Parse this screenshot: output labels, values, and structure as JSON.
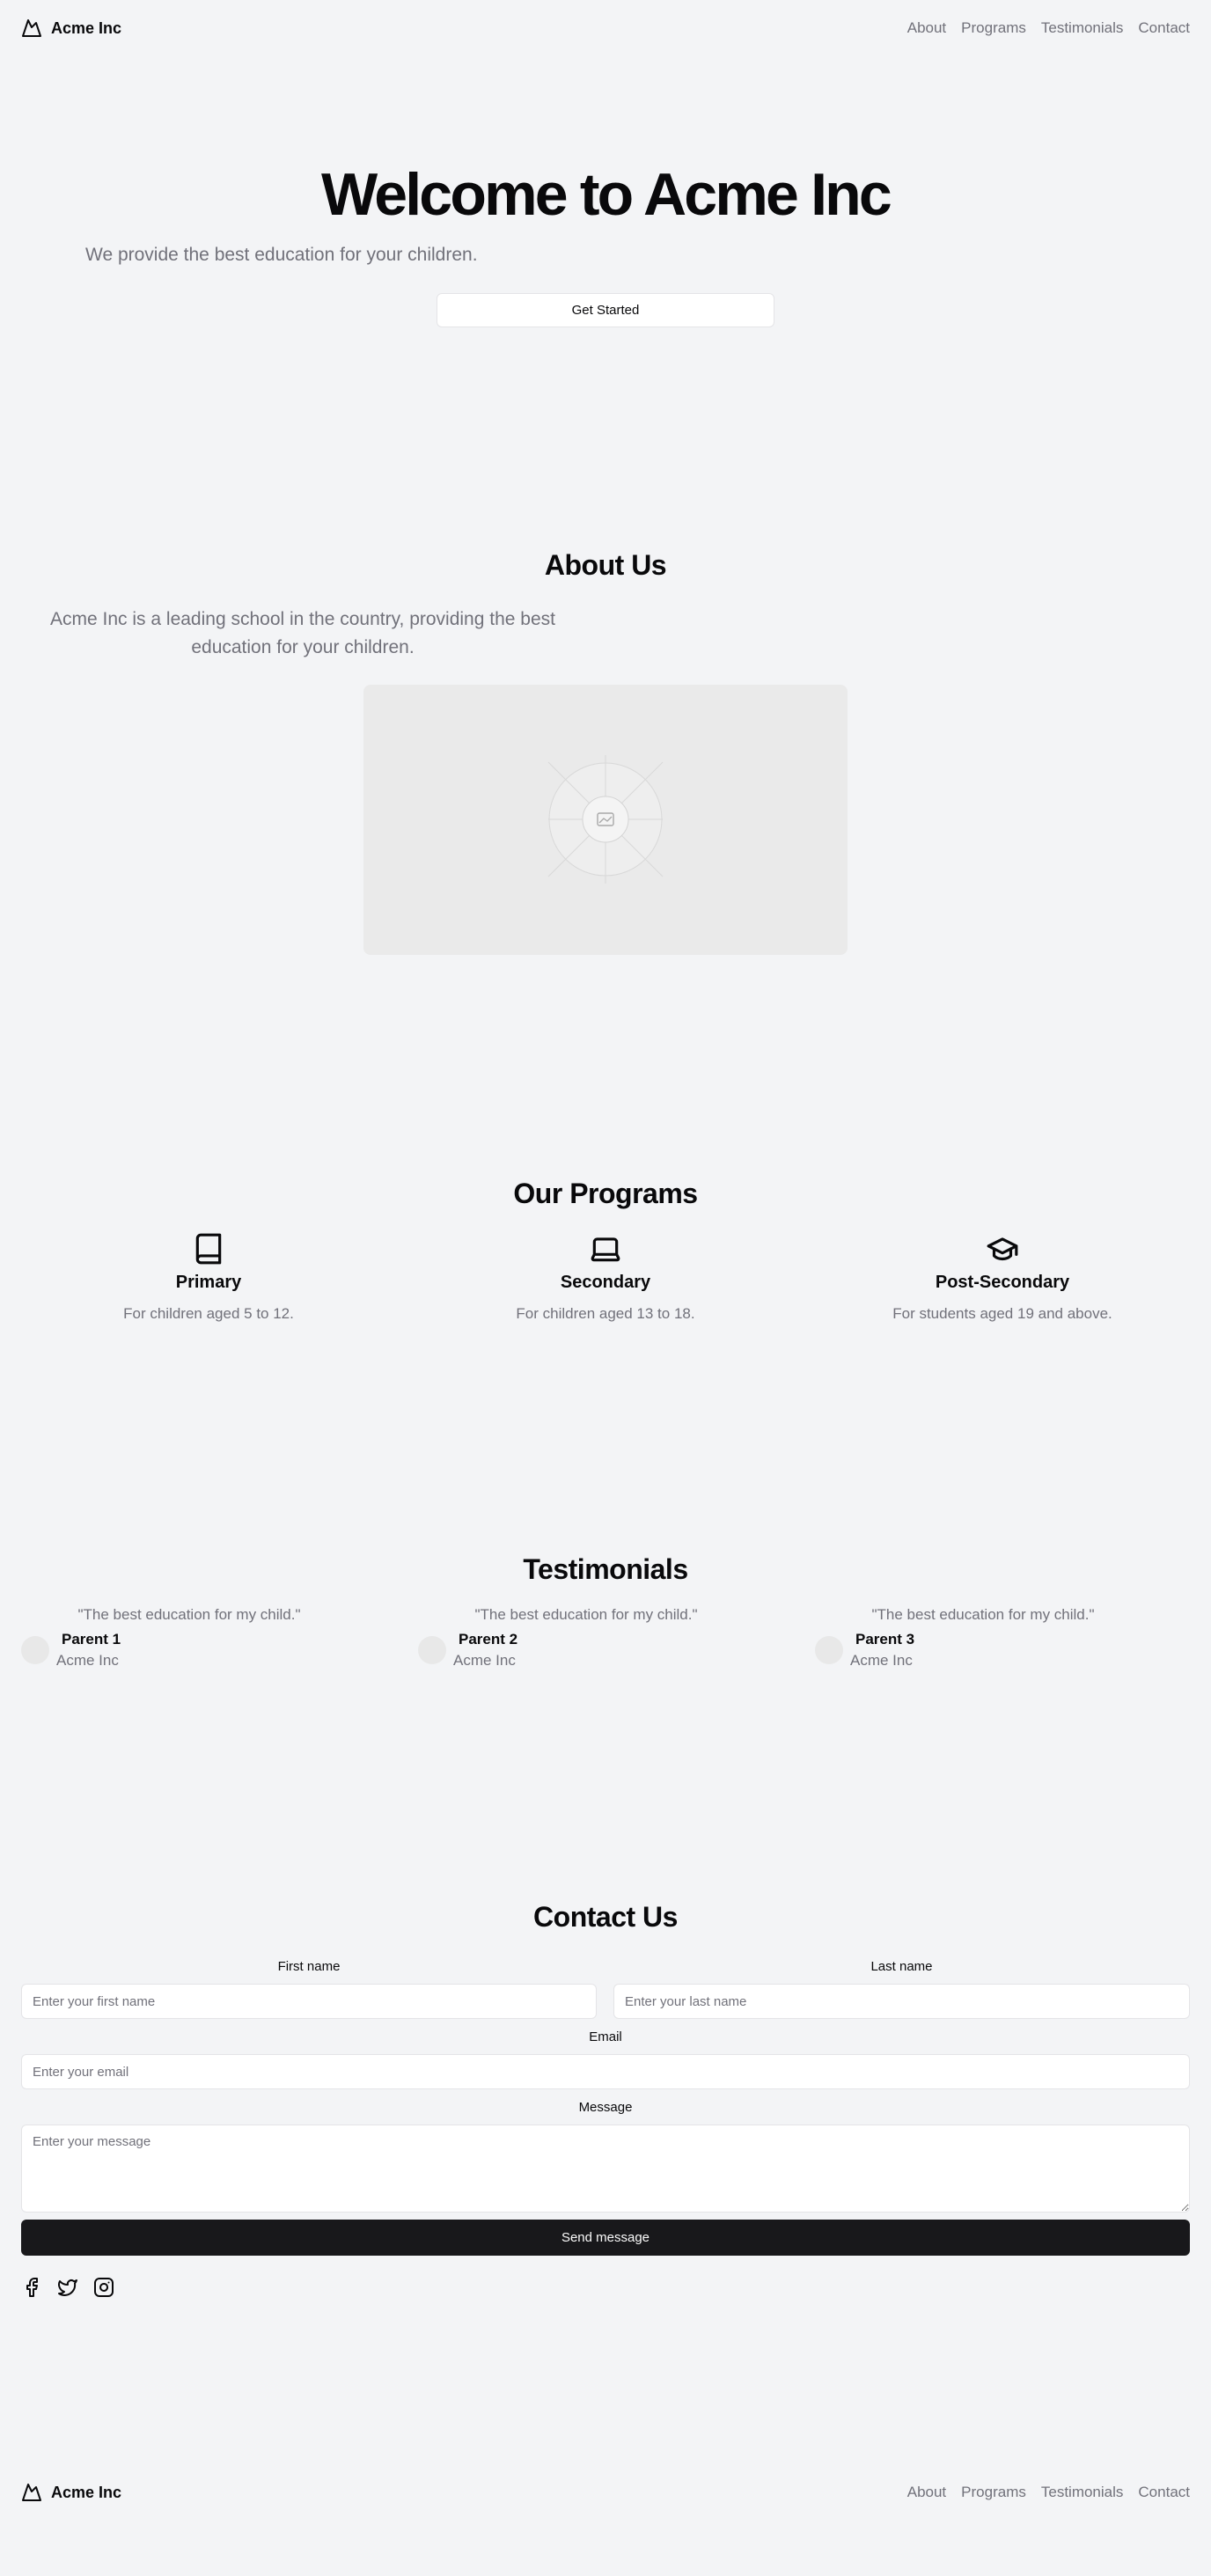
{
  "header": {
    "brand": "Acme Inc",
    "logo_icon": "mountain-icon",
    "nav": [
      "About",
      "Programs",
      "Testimonials",
      "Contact"
    ]
  },
  "hero": {
    "title": "Welcome to Acme Inc",
    "subtitle": "We provide the best education for your children.",
    "cta": "Get Started"
  },
  "about": {
    "title": "About Us",
    "text": "Acme Inc is a leading school in the country, providing the best education for your children.",
    "image_icon": "image-placeholder-icon"
  },
  "programs": {
    "title": "Our Programs",
    "items": [
      {
        "icon": "book-icon",
        "title": "Primary",
        "desc": "For children aged 5 to 12."
      },
      {
        "icon": "laptop-icon",
        "title": "Secondary",
        "desc": "For children aged 13 to 18."
      },
      {
        "icon": "graduation-cap-icon",
        "title": "Post-Secondary",
        "desc": "For students aged 19 and above."
      }
    ]
  },
  "testimonials": {
    "title": "Testimonials",
    "items": [
      {
        "quote": "\"The best education for my child.\"",
        "name": "Parent 1",
        "org": "Acme Inc"
      },
      {
        "quote": "\"The best education for my child.\"",
        "name": "Parent 2",
        "org": "Acme Inc"
      },
      {
        "quote": "\"The best education for my child.\"",
        "name": "Parent 3",
        "org": "Acme Inc"
      }
    ]
  },
  "contact": {
    "title": "Contact Us",
    "first_name_label": "First name",
    "first_name_placeholder": "Enter your first name",
    "last_name_label": "Last name",
    "last_name_placeholder": "Enter your last name",
    "email_label": "Email",
    "email_placeholder": "Enter your email",
    "message_label": "Message",
    "message_placeholder": "Enter your message",
    "submit": "Send message",
    "social_icons": [
      "facebook-icon",
      "twitter-icon",
      "instagram-icon"
    ]
  },
  "footer": {
    "brand": "Acme Inc",
    "nav": [
      "About",
      "Programs",
      "Testimonials",
      "Contact"
    ]
  },
  "colors": {
    "background": "#f3f4f6",
    "text": "#09090b",
    "muted": "#71717a",
    "primary_button": "#18181b",
    "border": "#e4e4e7"
  }
}
